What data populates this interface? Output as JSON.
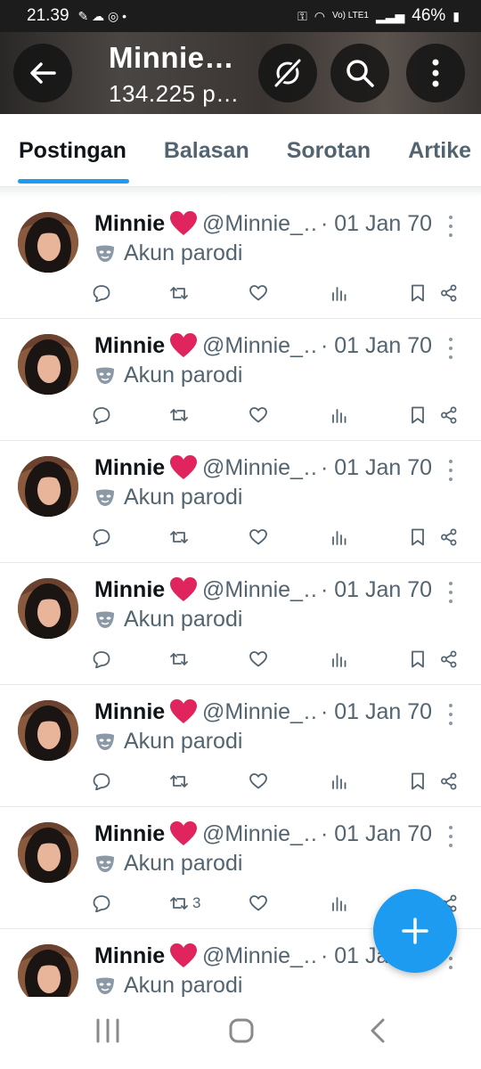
{
  "status_bar": {
    "time": "21.39",
    "battery": "46%",
    "network": "Vo) LTE1"
  },
  "header": {
    "title": "Minnie…",
    "subtitle": "134.225 p…"
  },
  "tabs": [
    {
      "label": "Postingan",
      "active": true
    },
    {
      "label": "Balasan",
      "active": false
    },
    {
      "label": "Sorotan",
      "active": false
    },
    {
      "label": "Artike",
      "active": false
    }
  ],
  "posts": [
    {
      "name": "Minnie",
      "handle": "@Minnie_…",
      "date": "· 01 Jan 70",
      "label": "Akun parodi",
      "retweets": ""
    },
    {
      "name": "Minnie",
      "handle": "@Minnie_…",
      "date": "· 01 Jan 70",
      "label": "Akun parodi",
      "retweets": ""
    },
    {
      "name": "Minnie",
      "handle": "@Minnie_…",
      "date": "· 01 Jan 70",
      "label": "Akun parodi",
      "retweets": ""
    },
    {
      "name": "Minnie",
      "handle": "@Minnie_…",
      "date": "· 01 Jan 70",
      "label": "Akun parodi",
      "retweets": ""
    },
    {
      "name": "Minnie",
      "handle": "@Minnie_…",
      "date": "· 01 Jan 70",
      "label": "Akun parodi",
      "retweets": ""
    },
    {
      "name": "Minnie",
      "handle": "@Minnie_…",
      "date": "· 01 Jan 70",
      "label": "Akun parodi",
      "retweets": "3"
    },
    {
      "name": "Minnie",
      "handle": "@Minnie_…",
      "date": "· 01 Jan 70",
      "label": "Akun parodi",
      "retweets": ""
    }
  ],
  "colors": {
    "accent": "#1d9bf0",
    "heart": "#e0245e",
    "secondary_text": "#536471"
  },
  "icons": [
    "back-arrow-icon",
    "grok-icon",
    "search-icon",
    "more-vertical-icon",
    "reply-icon",
    "retweet-icon",
    "like-icon",
    "views-icon",
    "bookmark-icon",
    "share-icon",
    "compose-plus-icon",
    "parody-mask-icon"
  ]
}
